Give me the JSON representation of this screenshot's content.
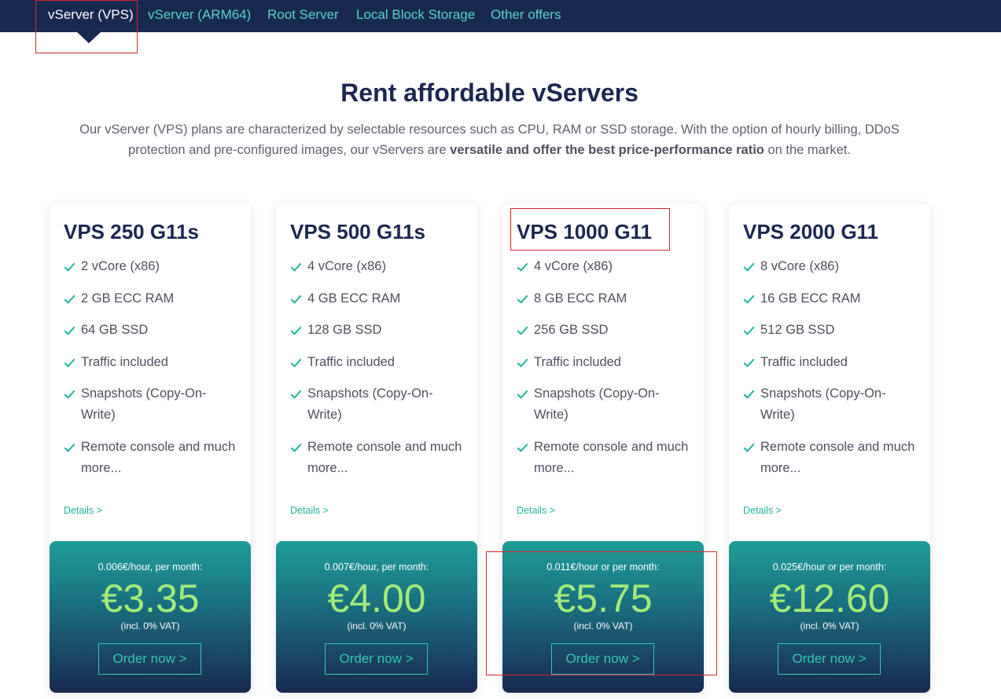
{
  "nav": {
    "items": [
      {
        "label": "vServer (VPS)",
        "active": true
      },
      {
        "label": "vServer (ARM64)",
        "active": false
      },
      {
        "label": "Root Server",
        "active": false
      },
      {
        "label": "Local Block Storage",
        "active": false
      },
      {
        "label": "Other offers",
        "active": false
      }
    ]
  },
  "hero": {
    "title": "Rent affordable vServers",
    "text_before": "Our vServer (VPS) plans are characterized by selectable resources such as CPU, RAM or SSD storage. With the option of hourly billing, DDoS protection and pre-configured images, our vServers are ",
    "text_bold": "versatile and offer the best price-performance ratio",
    "text_after": " on the market."
  },
  "plans": [
    {
      "name": "VPS 250 G11s",
      "features": [
        "2 vCore (x86)",
        "2 GB ECC RAM",
        "64 GB SSD",
        "Traffic included",
        "Snapshots (Copy-On-Write)",
        "Remote console and much more..."
      ],
      "details_label": "Details >",
      "price_note": "0.006€/hour, per month:",
      "price": "€3.35",
      "vat": "(incl. 0% VAT)",
      "order_label": "Order now >"
    },
    {
      "name": "VPS 500 G11s",
      "features": [
        "4 vCore (x86)",
        "4 GB ECC RAM",
        "128 GB SSD",
        "Traffic included",
        "Snapshots (Copy-On-Write)",
        "Remote console and much more..."
      ],
      "details_label": "Details >",
      "price_note": "0.007€/hour, per month:",
      "price": "€4.00",
      "vat": "(incl. 0% VAT)",
      "order_label": "Order now >"
    },
    {
      "name": "VPS 1000 G11",
      "features": [
        "4 vCore (x86)",
        "8 GB ECC RAM",
        "256 GB SSD",
        "Traffic included",
        "Snapshots (Copy-On-Write)",
        "Remote console and much more..."
      ],
      "details_label": "Details >",
      "price_note": "0.011€/hour or per month:",
      "price": "€5.75",
      "vat": "(incl. 0% VAT)",
      "order_label": "Order now >"
    },
    {
      "name": "VPS 2000 G11",
      "features": [
        "8 vCore (x86)",
        "16 GB ECC RAM",
        "512 GB SSD",
        "Traffic included",
        "Snapshots (Copy-On-Write)",
        "Remote console and much more..."
      ],
      "details_label": "Details >",
      "price_note": "0.025€/hour or per month:",
      "price": "€12.60",
      "vat": "(incl. 0% VAT)",
      "order_label": "Order now >"
    }
  ],
  "colors": {
    "nav_bg": "#18294f",
    "accent": "#1fb39f",
    "price_green": "#a4ea79",
    "highlight_box": "#d9242a"
  },
  "icons": {
    "feature": "check-icon"
  }
}
